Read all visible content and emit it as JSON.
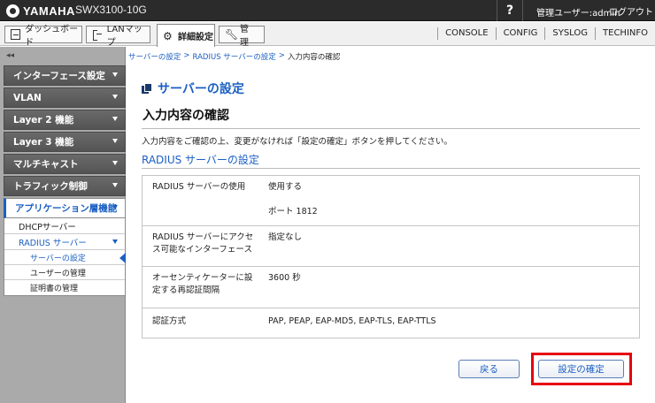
{
  "header": {
    "brand": "YAMAHA",
    "model": "SWX3100-10G",
    "help": "?",
    "user_label": "管理ユーザー:admin",
    "logout": "ログアウト"
  },
  "tabs": [
    {
      "label": "ダッシュボード",
      "icon": "dashboard-icon"
    },
    {
      "label": "LANマップ",
      "icon": "lan-map-icon"
    },
    {
      "label": "詳細設定",
      "icon": "gear-icon",
      "active": true
    },
    {
      "label": "管　理",
      "icon": "wrench-icon"
    }
  ],
  "top_links": [
    "CONSOLE",
    "CONFIG",
    "SYSLOG",
    "TECHINFO"
  ],
  "sidebar": {
    "collapse": "◂◂",
    "items": [
      {
        "label": "インターフェース設定"
      },
      {
        "label": "VLAN"
      },
      {
        "label": "Layer 2 機能"
      },
      {
        "label": "Layer 3 機能"
      },
      {
        "label": "マルチキャスト"
      },
      {
        "label": "トラフィック制御"
      },
      {
        "label": "アプリケーション層機能",
        "open": true
      }
    ],
    "sub": {
      "dhcp": "DHCPサーバー",
      "radius": "RADIUS サーバー",
      "server_settings": "サーバーの設定",
      "user_mgmt": "ユーザーの管理",
      "cert_mgmt": "証明書の管理"
    }
  },
  "breadcrumb": [
    "サーバーの設定",
    ">",
    "RADIUS サーバーの設定",
    ">",
    "入力内容の確認"
  ],
  "main": {
    "section_title": "サーバーの設定",
    "page_title": "入力内容の確認",
    "instruction": "入力内容をご確認の上、変更がなければ「設定の確定」ボタンを押してください。",
    "radius_title": "RADIUS サーバーの設定",
    "rows": [
      {
        "label": "RADIUS サーバーの使用",
        "values": [
          "使用する",
          "ポート 1812"
        ]
      },
      {
        "label": "RADIUS サーバーにアクセス可能なインターフェース",
        "values": [
          "指定なし"
        ]
      },
      {
        "label": "オーセンティケーターに設定する再認証間隔",
        "values": [
          "3600 秒"
        ]
      },
      {
        "label": "認証方式",
        "values": [
          "PAP, PEAP, EAP-MD5, EAP-TLS, EAP-TTLS"
        ]
      }
    ],
    "back_button": "戻る",
    "confirm_button": "設定の確定"
  },
  "colors": {
    "accent": "#1b5fc2",
    "header_bg": "#2b2b2b",
    "sidebar_bg": "#aaaaaa",
    "highlight": "#e60012"
  }
}
